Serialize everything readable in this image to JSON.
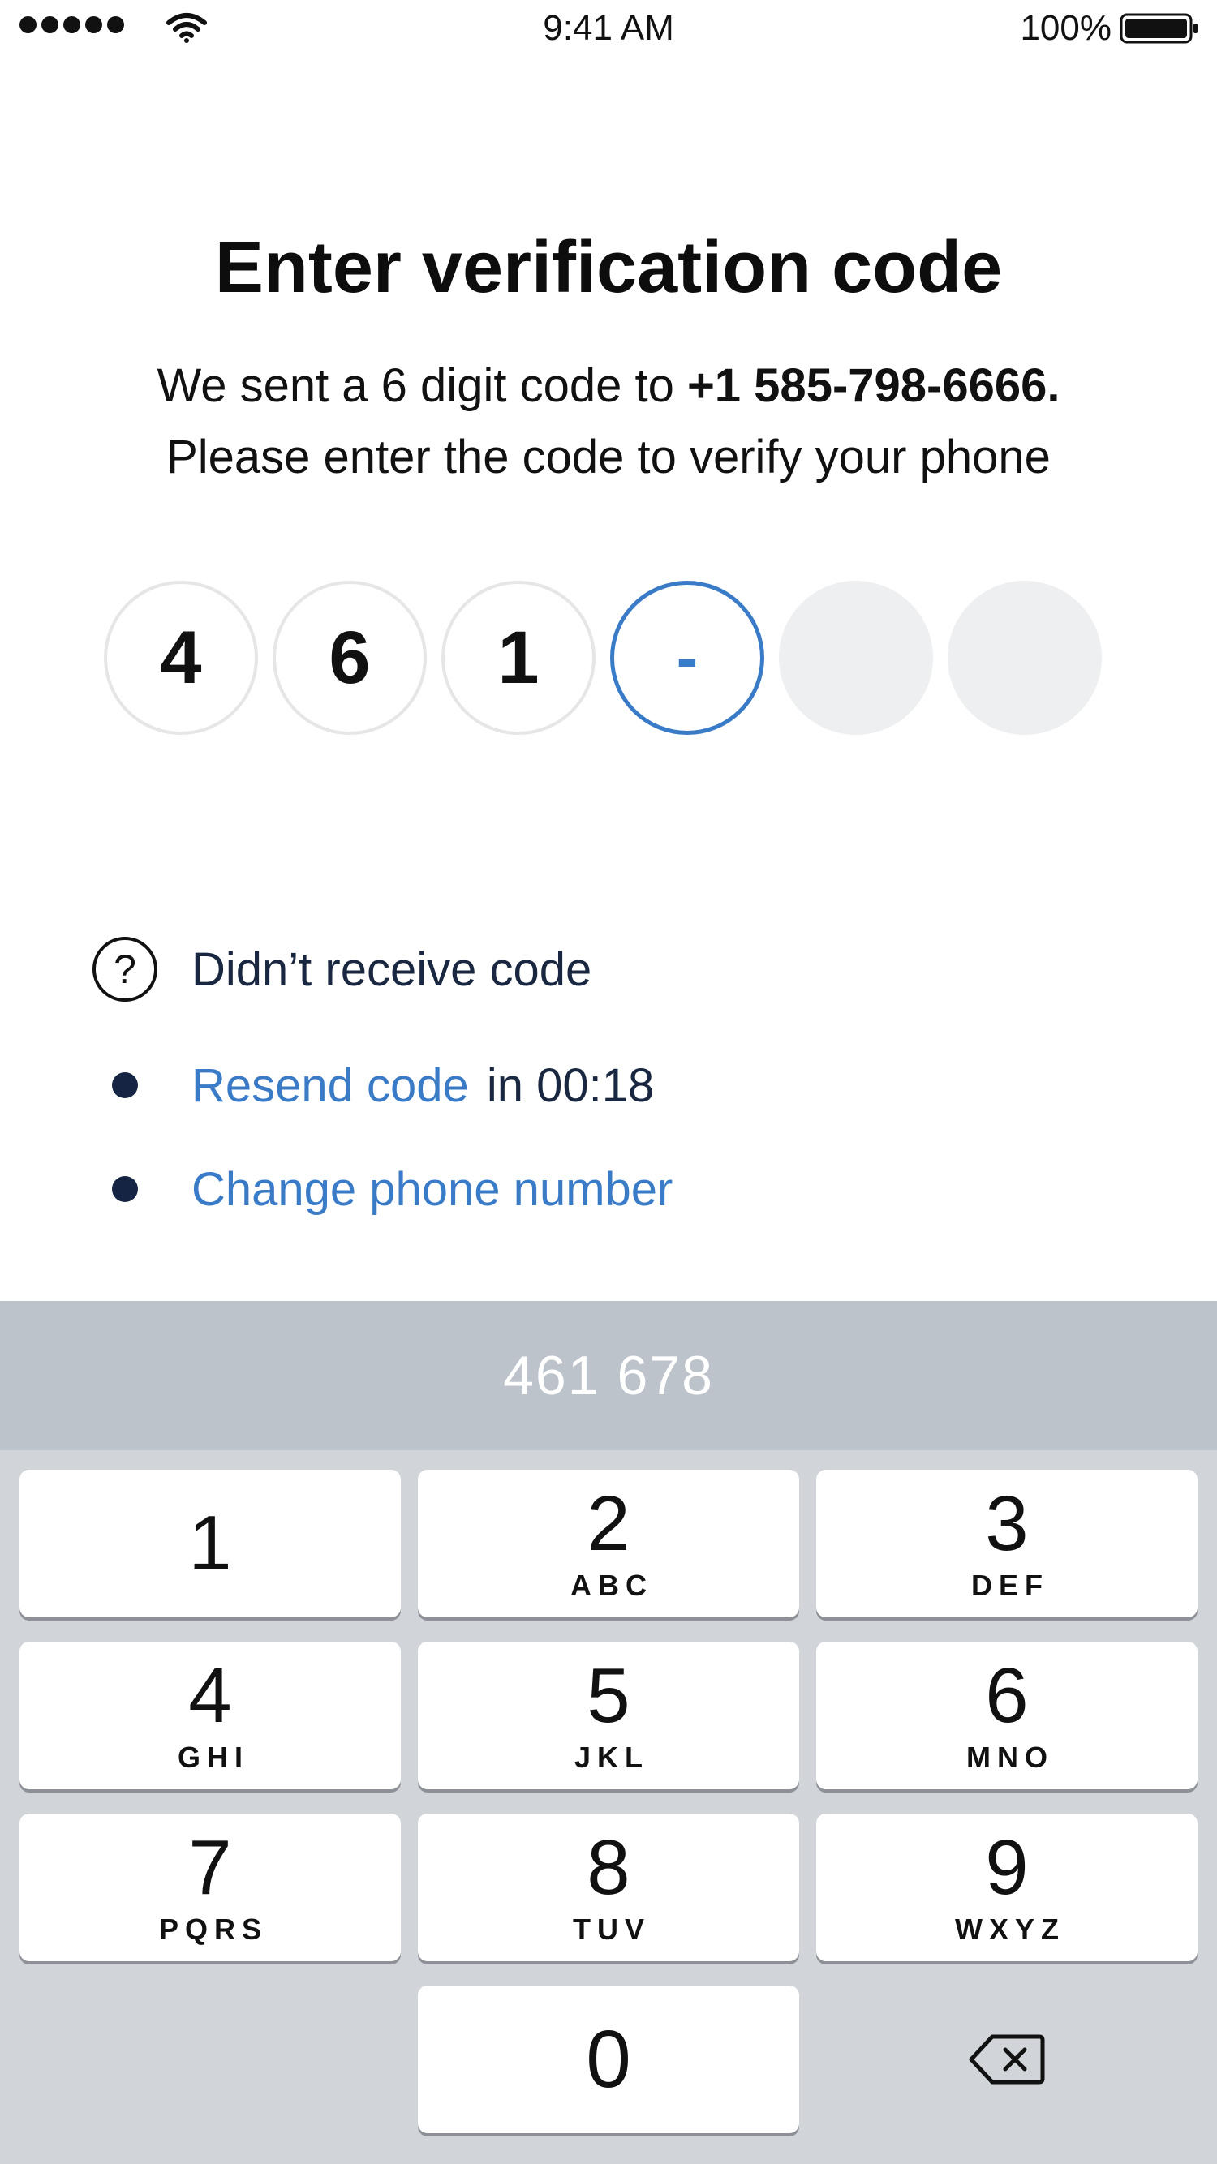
{
  "status_bar": {
    "signal_icon": "signal-dots-icon",
    "wifi_icon": "wifi-icon",
    "time": "9:41 AM",
    "battery_percent": "100%",
    "battery_icon": "battery-full-icon"
  },
  "heading": {
    "title": "Enter verification code",
    "subtitle_line1_prefix": "We sent a 6 digit code to ",
    "phone": "+1 585-798-6666.",
    "subtitle_line2": "Please enter the code to verify your phone"
  },
  "code": {
    "cells": [
      "4",
      "6",
      "1",
      "-",
      "",
      ""
    ],
    "active_index": 3,
    "active_color": "#3a7bc8"
  },
  "help": {
    "question_icon": "question-circle-icon",
    "title": "Didn’t receive code",
    "resend_label": "Resend code",
    "resend_countdown": "in 00:18",
    "change_label": "Change phone number",
    "link_color": "#3a7bc8"
  },
  "keyboard": {
    "suggestion": "461 678",
    "keys": [
      {
        "digit": "1",
        "letters": ""
      },
      {
        "digit": "2",
        "letters": "ABC"
      },
      {
        "digit": "3",
        "letters": "DEF"
      },
      {
        "digit": "4",
        "letters": "GHI"
      },
      {
        "digit": "5",
        "letters": "JKL"
      },
      {
        "digit": "6",
        "letters": "MNO"
      },
      {
        "digit": "7",
        "letters": "PQRS"
      },
      {
        "digit": "8",
        "letters": "TUV"
      },
      {
        "digit": "9",
        "letters": "WXYZ"
      },
      {
        "digit": "0",
        "letters": ""
      }
    ],
    "delete_icon": "backspace-icon"
  }
}
